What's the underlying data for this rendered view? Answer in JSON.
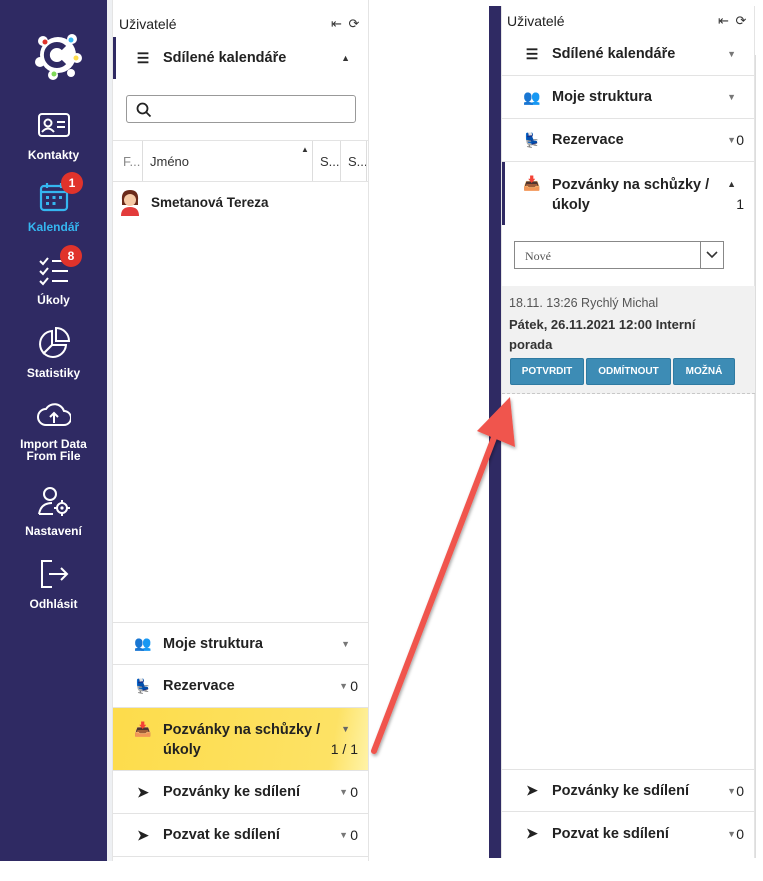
{
  "nav": {
    "items": [
      {
        "label": "Kontakty",
        "icon": "contact-card-icon"
      },
      {
        "label": "Kalendář",
        "icon": "calendar-icon",
        "badge": "1",
        "active": true
      },
      {
        "label": "Úkoly",
        "icon": "checklist-icon",
        "badge": "8"
      },
      {
        "label": "Statistiky",
        "icon": "pie-chart-icon"
      },
      {
        "label": "Import Data From File",
        "icon": "cloud-upload-icon"
      },
      {
        "label": "Nastavení",
        "icon": "user-settings-icon"
      },
      {
        "label": "Odhlásit",
        "icon": "logout-icon"
      }
    ]
  },
  "left_panel": {
    "title": "Uživatelé",
    "sections": {
      "shared_calendars": "Sdílené kalendáře",
      "my_structure": "Moje struktura",
      "reservations": "Rezervace",
      "reservations_count": "0",
      "meeting_invites": "Pozvánky na schůzky / úkoly",
      "meeting_invites_count": "1 / 1",
      "share_invites": "Pozvánky ke sdílení",
      "share_invites_count": "0",
      "invite_share": "Pozvat ke sdílení",
      "invite_share_count": "0"
    },
    "table": {
      "col_f": "F...",
      "col_name": "Jméno",
      "col_s1": "S...",
      "col_s2": "S...",
      "rows": [
        {
          "name": "Smetanová Tereza"
        }
      ]
    }
  },
  "right_panel": {
    "title": "Uživatelé",
    "sections": {
      "shared_calendars": "Sdílené kalendáře",
      "my_structure": "Moje struktura",
      "reservations": "Rezervace",
      "reservations_count": "0",
      "meeting_invites_line1": "Pozvánky na schůzky /",
      "meeting_invites_line2": "úkoly",
      "meeting_invites_count": "1",
      "share_invites": "Pozvánky ke sdílení",
      "share_invites_count": "0",
      "invite_share": "Pozvat ke sdílení",
      "invite_share_count": "0"
    },
    "filter": {
      "selected": "Nové"
    },
    "invite": {
      "meta": "18.11. 13:26 Rychlý Michal",
      "title": "Pátek, 26.11.2021 12:00 Interní porada",
      "buttons": {
        "confirm": "POTVRDIT",
        "decline": "ODMÍTNOUT",
        "maybe": "MOŽNÁ"
      }
    }
  },
  "colors": {
    "nav_bg": "#2f2a63",
    "active": "#35b6f0",
    "badge": "#e0332b",
    "highlight": "#fddc4b",
    "button": "#3d8cb5",
    "arrow": "#f0554e"
  }
}
